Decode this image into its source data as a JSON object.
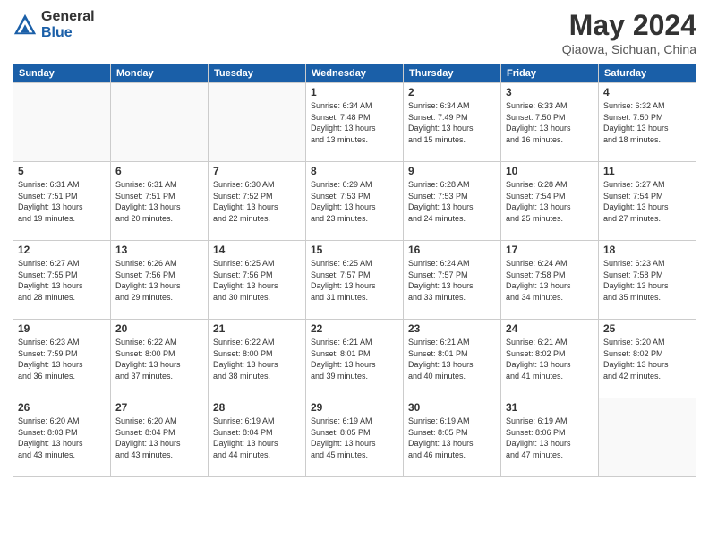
{
  "logo": {
    "general": "General",
    "blue": "Blue"
  },
  "header": {
    "month": "May 2024",
    "location": "Qiaowa, Sichuan, China"
  },
  "days_of_week": [
    "Sunday",
    "Monday",
    "Tuesday",
    "Wednesday",
    "Thursday",
    "Friday",
    "Saturday"
  ],
  "weeks": [
    [
      {
        "day": "",
        "info": ""
      },
      {
        "day": "",
        "info": ""
      },
      {
        "day": "",
        "info": ""
      },
      {
        "day": "1",
        "info": "Sunrise: 6:34 AM\nSunset: 7:48 PM\nDaylight: 13 hours\nand 13 minutes."
      },
      {
        "day": "2",
        "info": "Sunrise: 6:34 AM\nSunset: 7:49 PM\nDaylight: 13 hours\nand 15 minutes."
      },
      {
        "day": "3",
        "info": "Sunrise: 6:33 AM\nSunset: 7:50 PM\nDaylight: 13 hours\nand 16 minutes."
      },
      {
        "day": "4",
        "info": "Sunrise: 6:32 AM\nSunset: 7:50 PM\nDaylight: 13 hours\nand 18 minutes."
      }
    ],
    [
      {
        "day": "5",
        "info": "Sunrise: 6:31 AM\nSunset: 7:51 PM\nDaylight: 13 hours\nand 19 minutes."
      },
      {
        "day": "6",
        "info": "Sunrise: 6:31 AM\nSunset: 7:51 PM\nDaylight: 13 hours\nand 20 minutes."
      },
      {
        "day": "7",
        "info": "Sunrise: 6:30 AM\nSunset: 7:52 PM\nDaylight: 13 hours\nand 22 minutes."
      },
      {
        "day": "8",
        "info": "Sunrise: 6:29 AM\nSunset: 7:53 PM\nDaylight: 13 hours\nand 23 minutes."
      },
      {
        "day": "9",
        "info": "Sunrise: 6:28 AM\nSunset: 7:53 PM\nDaylight: 13 hours\nand 24 minutes."
      },
      {
        "day": "10",
        "info": "Sunrise: 6:28 AM\nSunset: 7:54 PM\nDaylight: 13 hours\nand 25 minutes."
      },
      {
        "day": "11",
        "info": "Sunrise: 6:27 AM\nSunset: 7:54 PM\nDaylight: 13 hours\nand 27 minutes."
      }
    ],
    [
      {
        "day": "12",
        "info": "Sunrise: 6:27 AM\nSunset: 7:55 PM\nDaylight: 13 hours\nand 28 minutes."
      },
      {
        "day": "13",
        "info": "Sunrise: 6:26 AM\nSunset: 7:56 PM\nDaylight: 13 hours\nand 29 minutes."
      },
      {
        "day": "14",
        "info": "Sunrise: 6:25 AM\nSunset: 7:56 PM\nDaylight: 13 hours\nand 30 minutes."
      },
      {
        "day": "15",
        "info": "Sunrise: 6:25 AM\nSunset: 7:57 PM\nDaylight: 13 hours\nand 31 minutes."
      },
      {
        "day": "16",
        "info": "Sunrise: 6:24 AM\nSunset: 7:57 PM\nDaylight: 13 hours\nand 33 minutes."
      },
      {
        "day": "17",
        "info": "Sunrise: 6:24 AM\nSunset: 7:58 PM\nDaylight: 13 hours\nand 34 minutes."
      },
      {
        "day": "18",
        "info": "Sunrise: 6:23 AM\nSunset: 7:58 PM\nDaylight: 13 hours\nand 35 minutes."
      }
    ],
    [
      {
        "day": "19",
        "info": "Sunrise: 6:23 AM\nSunset: 7:59 PM\nDaylight: 13 hours\nand 36 minutes."
      },
      {
        "day": "20",
        "info": "Sunrise: 6:22 AM\nSunset: 8:00 PM\nDaylight: 13 hours\nand 37 minutes."
      },
      {
        "day": "21",
        "info": "Sunrise: 6:22 AM\nSunset: 8:00 PM\nDaylight: 13 hours\nand 38 minutes."
      },
      {
        "day": "22",
        "info": "Sunrise: 6:21 AM\nSunset: 8:01 PM\nDaylight: 13 hours\nand 39 minutes."
      },
      {
        "day": "23",
        "info": "Sunrise: 6:21 AM\nSunset: 8:01 PM\nDaylight: 13 hours\nand 40 minutes."
      },
      {
        "day": "24",
        "info": "Sunrise: 6:21 AM\nSunset: 8:02 PM\nDaylight: 13 hours\nand 41 minutes."
      },
      {
        "day": "25",
        "info": "Sunrise: 6:20 AM\nSunset: 8:02 PM\nDaylight: 13 hours\nand 42 minutes."
      }
    ],
    [
      {
        "day": "26",
        "info": "Sunrise: 6:20 AM\nSunset: 8:03 PM\nDaylight: 13 hours\nand 43 minutes."
      },
      {
        "day": "27",
        "info": "Sunrise: 6:20 AM\nSunset: 8:04 PM\nDaylight: 13 hours\nand 43 minutes."
      },
      {
        "day": "28",
        "info": "Sunrise: 6:19 AM\nSunset: 8:04 PM\nDaylight: 13 hours\nand 44 minutes."
      },
      {
        "day": "29",
        "info": "Sunrise: 6:19 AM\nSunset: 8:05 PM\nDaylight: 13 hours\nand 45 minutes."
      },
      {
        "day": "30",
        "info": "Sunrise: 6:19 AM\nSunset: 8:05 PM\nDaylight: 13 hours\nand 46 minutes."
      },
      {
        "day": "31",
        "info": "Sunrise: 6:19 AM\nSunset: 8:06 PM\nDaylight: 13 hours\nand 47 minutes."
      },
      {
        "day": "",
        "info": ""
      }
    ]
  ]
}
